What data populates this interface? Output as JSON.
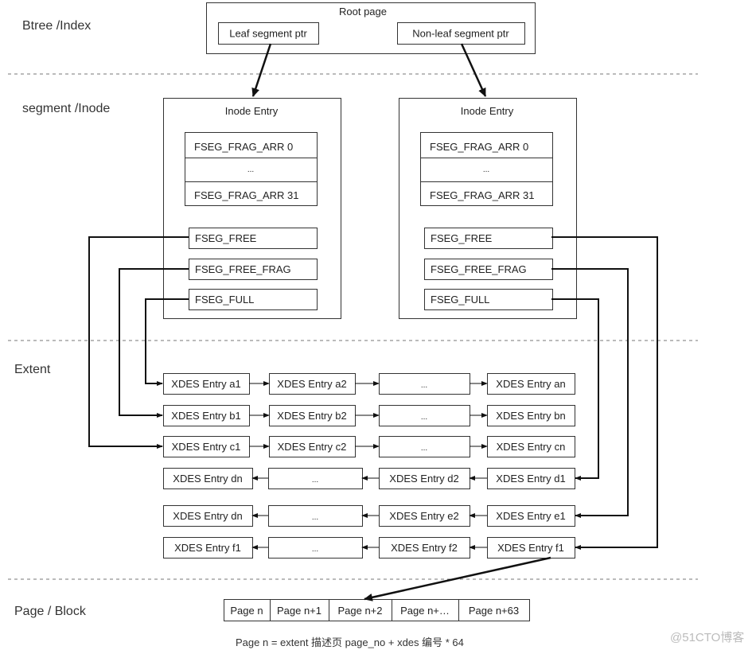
{
  "layers": {
    "btree": "Btree /Index",
    "segment": "segment /Inode",
    "extent": "Extent",
    "page": "Page / Block"
  },
  "root": {
    "title": "Root page",
    "leaf_ptr": "Leaf segment ptr",
    "nonleaf_ptr": "Non-leaf segment ptr"
  },
  "inodes": [
    {
      "title": "Inode Entry",
      "frag": [
        "FSEG_FRAG_ARR 0",
        "...",
        "FSEG_FRAG_ARR 31"
      ],
      "lists": [
        "FSEG_FREE",
        "FSEG_FREE_FRAG",
        "FSEG_FULL"
      ]
    },
    {
      "title": "Inode Entry",
      "frag": [
        "FSEG_FRAG_ARR 0",
        "...",
        "FSEG_FRAG_ARR 31"
      ],
      "lists": [
        "FSEG_FREE",
        "FSEG_FREE_FRAG",
        "FSEG_FULL"
      ]
    }
  ],
  "xdes_rows": [
    {
      "direction": "right",
      "cells": [
        "XDES Entry a1",
        "XDES Entry  a2",
        "...",
        "XDES Entry an"
      ]
    },
    {
      "direction": "right",
      "cells": [
        "XDES Entry b1",
        "XDES Entry  b2",
        "...",
        "XDES Entry bn"
      ]
    },
    {
      "direction": "right",
      "cells": [
        "XDES Entry c1",
        "XDES Entry  c2",
        "...",
        "XDES Entry cn"
      ]
    },
    {
      "direction": "left",
      "cells": [
        "XDES Entry dn",
        "...",
        "XDES Entry  d2",
        "XDES Entry d1"
      ]
    },
    {
      "direction": "left",
      "cells": [
        "XDES Entry dn",
        "...",
        "XDES Entry  e2",
        "XDES Entry e1"
      ]
    },
    {
      "direction": "left",
      "cells": [
        "XDES Entry f1",
        "...",
        "XDES Entry  f2",
        "XDES Entry f1"
      ]
    }
  ],
  "pages": [
    "Page n",
    "Page n+1",
    "Page n+2",
    "Page n+…",
    "Page n+63"
  ],
  "formula": "Page n = extent 描述页 page_no + xdes 编号 * 64",
  "watermark": "@51CTO博客"
}
